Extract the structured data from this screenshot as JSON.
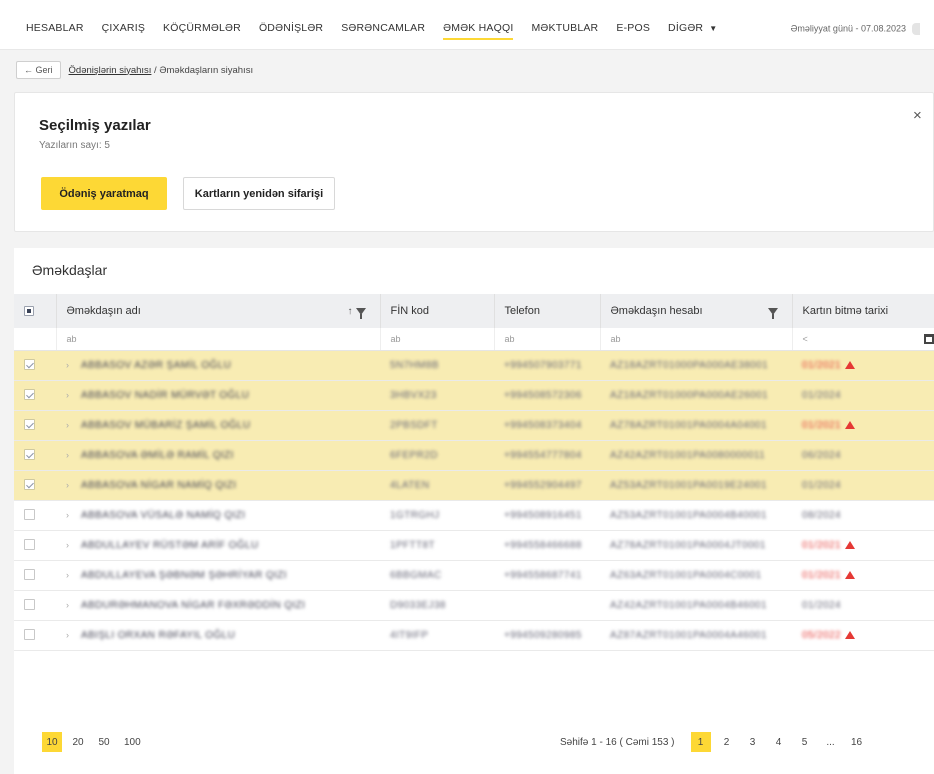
{
  "nav": {
    "items": [
      "HESABLAR",
      "ÇIXARIŞ",
      "KÖÇÜRMƏLƏR",
      "ÖDƏNİŞLƏR",
      "SƏRƏNCAMLAR",
      "ƏMƏK HAQQI",
      "MƏKTUBLAR",
      "E-POS",
      "DİGƏR"
    ],
    "active_index": 5,
    "opday": "Əməliyyat günü - 07.08.2023"
  },
  "breadcrumb": {
    "back": "← Geri",
    "link": "Ödənişlərin siyahısı",
    "separator": " / ",
    "current": "Əməkdaşların siyahısı"
  },
  "selection": {
    "title": "Seçilmiş yazılar",
    "count_text": "Yazıların sayı: 5",
    "close": "×",
    "primary_button": "Ödəniş yaratmaq",
    "secondary_button": "Kartların yenidən sifarişi"
  },
  "table": {
    "title": "Əməkdaşlar",
    "headers": {
      "name": "Əməkdaşın adı",
      "fin": "FİN kod",
      "phone": "Telefon",
      "account": "Əməkdaşın hesabı",
      "expiry": "Kartın bitmə tarixi"
    },
    "filters": {
      "name": "ab",
      "fin": "ab",
      "phone": "ab",
      "account": "ab",
      "expiry": "<"
    },
    "rows": [
      {
        "name": "ABBASOV AZƏR ŞAMİL OĞLU",
        "fin": "5N7HM8B",
        "phone": "+994507903771",
        "account": "AZ18AZRT01000PA000AE38001",
        "expiry": "01/2021",
        "expired": true,
        "selected": true
      },
      {
        "name": "ABBASOV NADİR MÜRVƏT OĞLU",
        "fin": "3HBVX23",
        "phone": "+994508572306",
        "account": "AZ18AZRT01000PA000AE26001",
        "expiry": "01/2024",
        "expired": false,
        "selected": true
      },
      {
        "name": "ABBASOV MÜBARİZ ŞAMİL OĞLU",
        "fin": "2PBSDFT",
        "phone": "+994508373404",
        "account": "AZ78AZRT01001PA0004A04001",
        "expiry": "01/2021",
        "expired": true,
        "selected": true
      },
      {
        "name": "ABBASOVA ƏMİLƏ RAMİL QIZI",
        "fin": "6FEPR2D",
        "phone": "+994554777804",
        "account": "AZ42AZRT01001PA0080000011",
        "expiry": "06/2024",
        "expired": false,
        "selected": true
      },
      {
        "name": "ABBASOVA NİGAR NAMİQ QIZI",
        "fin": "4LATEN",
        "phone": "+994552904497",
        "account": "AZ53AZRT01001PA0019E24001",
        "expiry": "01/2024",
        "expired": false,
        "selected": true
      },
      {
        "name": "ABBASOVA VÜSALƏ NAMİQ QIZI",
        "fin": "1GTRGHJ",
        "phone": "+994508916451",
        "account": "AZ53AZRT01001PA0004B40001",
        "expiry": "08/2024",
        "expired": false,
        "selected": false
      },
      {
        "name": "ABDULLAYEV RÜSTƏM ARİF OĞLU",
        "fin": "1PFTT8T",
        "phone": "+994558466688",
        "account": "AZ78AZRT01001PA0004JT0001",
        "expiry": "01/2021",
        "expired": true,
        "selected": false
      },
      {
        "name": "ABDULLAYEVA ŞƏBNƏM ŞƏHRİYAR QIZI",
        "fin": "6BBGMAC",
        "phone": "+994558687741",
        "account": "AZ63AZRT01001PA0004C0001",
        "expiry": "01/2021",
        "expired": true,
        "selected": false
      },
      {
        "name": "ABDURƏHMANOVA NİGAR FƏXRƏDDİN QIZI",
        "fin": "D9033EJ38",
        "phone": "",
        "account": "AZ42AZRT01001PA0004B46001",
        "expiry": "01/2024",
        "expired": false,
        "selected": false
      },
      {
        "name": "ABIŞLI ORXAN RƏFAYIL OĞLU",
        "fin": "4IT9IFP",
        "phone": "+994509280985",
        "account": "AZ87AZRT01001PA0004A46001",
        "expiry": "05/2022",
        "expired": true,
        "selected": false
      }
    ]
  },
  "pagination": {
    "sizes": [
      "10",
      "20",
      "50",
      "100"
    ],
    "active_size_index": 0,
    "summary": "Səhifə 1 - 16 ( Cəmi 153 )",
    "pages": [
      "1",
      "2",
      "3",
      "4",
      "5",
      "...",
      "16"
    ],
    "active_page_index": 0
  },
  "colors": {
    "accent": "#fdd835",
    "selected_row": "#f8ecb3",
    "expired": "#e53935"
  }
}
